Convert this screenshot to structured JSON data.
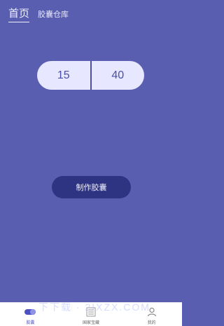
{
  "top_tabs": [
    {
      "label": "首页",
      "active": true
    },
    {
      "label": "胶囊仓库",
      "active": false
    }
  ],
  "capsule": {
    "left_value": "15",
    "right_value": "40"
  },
  "make_button": {
    "label": "制作胶囊"
  },
  "bottom_nav": [
    {
      "label": "胶囊",
      "icon": "capsule-icon",
      "active": true
    },
    {
      "label": "国家宝藏",
      "icon": "treasure-icon",
      "active": false
    },
    {
      "label": "我的",
      "icon": "user-icon",
      "active": false
    }
  ],
  "watermark": "下下载 · 2IXZX.COM",
  "colors": {
    "background": "#5a5eb0",
    "capsule_fill": "#e7e7ff",
    "button_fill": "#2f3482",
    "accent": "#4c50c0"
  }
}
